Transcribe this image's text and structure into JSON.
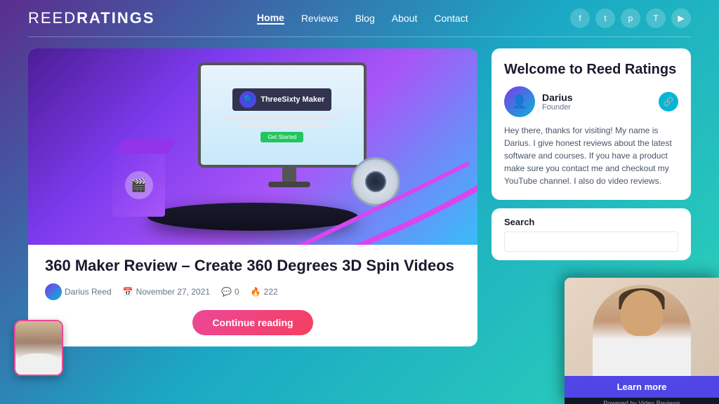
{
  "header": {
    "logo": "ReedRatings",
    "nav": {
      "items": [
        {
          "label": "Home",
          "active": true
        },
        {
          "label": "Reviews",
          "active": false
        },
        {
          "label": "Blog",
          "active": false
        },
        {
          "label": "About",
          "active": false
        },
        {
          "label": "Contact",
          "active": false
        }
      ]
    },
    "social": [
      "f",
      "t",
      "p",
      "T",
      "▶"
    ]
  },
  "article": {
    "title": "360 Maker Review – Create 360 Degrees 3D Spin Videos",
    "author": "Darius Reed",
    "date": "November 27, 2021",
    "comments": "0",
    "likes": "222",
    "continue_label": "Continue reading"
  },
  "sidebar": {
    "welcome_title": "Welcome to Reed Ratings",
    "author_name": "Darius",
    "author_role": "Founder",
    "welcome_text": "Hey there, thanks for visiting! My name is Darius. I give honest reviews about the latest software and courses. If you have a product make sure you contact me and checkout my YouTube channel. I also do video reviews.",
    "search_label": "Search",
    "search_placeholder": ""
  },
  "video_popup": {
    "learn_more_label": "Learn more",
    "powered_label": "Powered by Video Reviews"
  }
}
